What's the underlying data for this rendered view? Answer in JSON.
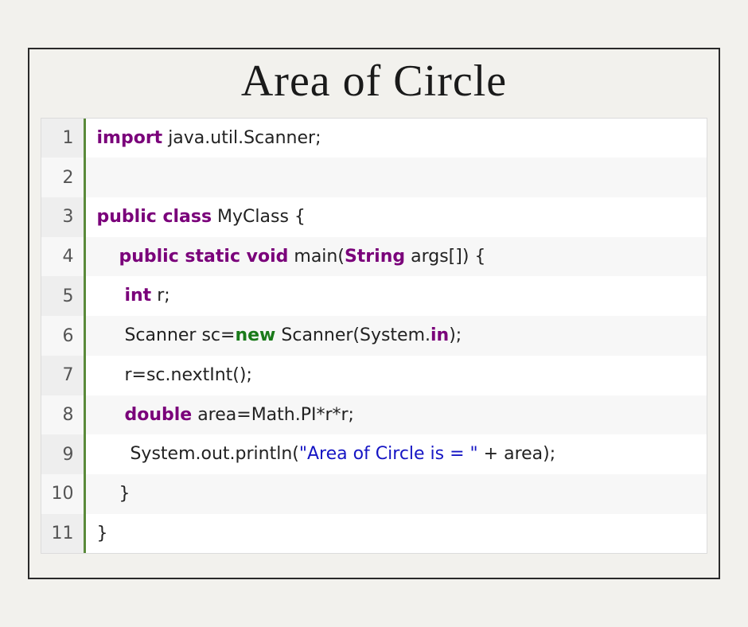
{
  "title": "Area of Circle",
  "code": {
    "lines": [
      {
        "num": "1",
        "tokens": [
          {
            "cls": "kw",
            "t": "import"
          },
          {
            "cls": "",
            "t": " java.util.Scanner;"
          }
        ]
      },
      {
        "num": "2",
        "tokens": []
      },
      {
        "num": "3",
        "tokens": [
          {
            "cls": "kw",
            "t": "public class"
          },
          {
            "cls": "",
            "t": " MyClass {"
          }
        ]
      },
      {
        "num": "4",
        "tokens": [
          {
            "cls": "",
            "t": "    "
          },
          {
            "cls": "kw",
            "t": "public static void"
          },
          {
            "cls": "",
            "t": " main("
          },
          {
            "cls": "kw",
            "t": "String"
          },
          {
            "cls": "",
            "t": " args[]) {"
          }
        ]
      },
      {
        "num": "5",
        "tokens": [
          {
            "cls": "",
            "t": "     "
          },
          {
            "cls": "kw",
            "t": "int"
          },
          {
            "cls": "",
            "t": " r;"
          }
        ]
      },
      {
        "num": "6",
        "tokens": [
          {
            "cls": "",
            "t": "     Scanner sc="
          },
          {
            "cls": "kw2",
            "t": "new"
          },
          {
            "cls": "",
            "t": " Scanner(System."
          },
          {
            "cls": "fld",
            "t": "in"
          },
          {
            "cls": "",
            "t": ");"
          }
        ]
      },
      {
        "num": "7",
        "tokens": [
          {
            "cls": "",
            "t": "     r=sc.nextInt();"
          }
        ]
      },
      {
        "num": "8",
        "tokens": [
          {
            "cls": "",
            "t": "     "
          },
          {
            "cls": "kw",
            "t": "double"
          },
          {
            "cls": "",
            "t": " area=Math.PI*r*r;"
          }
        ]
      },
      {
        "num": "9",
        "tokens": [
          {
            "cls": "",
            "t": "      System.out.println("
          },
          {
            "cls": "str",
            "t": "\"Area of Circle is = \""
          },
          {
            "cls": "",
            "t": " + area);"
          }
        ]
      },
      {
        "num": "10",
        "tokens": [
          {
            "cls": "",
            "t": "    }"
          }
        ]
      },
      {
        "num": "11",
        "tokens": [
          {
            "cls": "",
            "t": "}"
          }
        ]
      }
    ]
  }
}
